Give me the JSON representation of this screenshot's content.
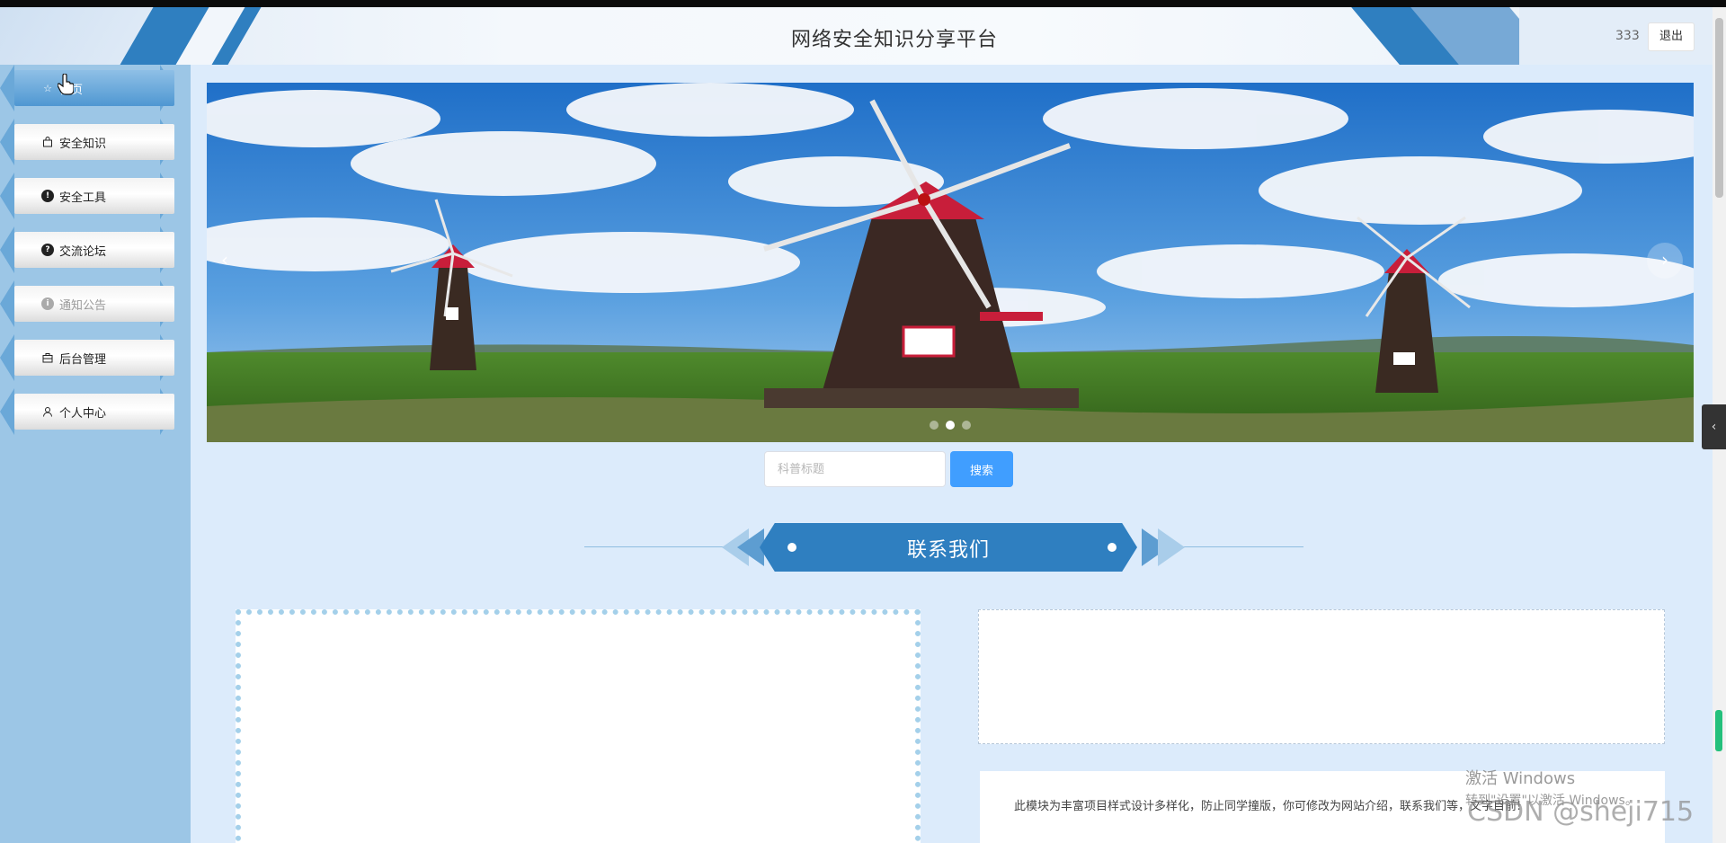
{
  "header": {
    "title": "网络安全知识分享平台",
    "username": "333",
    "logout_label": "退出"
  },
  "sidebar": {
    "items": [
      {
        "label": "首页",
        "icon": "star-icon",
        "state": "active"
      },
      {
        "label": "安全知识",
        "icon": "bag-icon",
        "state": "normal"
      },
      {
        "label": "安全工具",
        "icon": "info-circle-icon",
        "state": "normal"
      },
      {
        "label": "交流论坛",
        "icon": "question-circle-icon",
        "state": "normal"
      },
      {
        "label": "通知公告",
        "icon": "info-circle-icon",
        "state": "muted"
      },
      {
        "label": "后台管理",
        "icon": "briefcase-icon",
        "state": "normal"
      },
      {
        "label": "个人中心",
        "icon": "user-icon",
        "state": "normal"
      }
    ]
  },
  "banner": {
    "prev_icon": "‹",
    "next_icon": "›",
    "slide_count": 3,
    "active_slide": 2
  },
  "search": {
    "placeholder": "科普标题",
    "button_label": "搜索"
  },
  "section": {
    "title": "联系我们"
  },
  "intro": {
    "text": "此模块为丰富项目样式设计多样化，防止同学撞版，你可修改为网站介绍，联系我们等，文字目前!"
  },
  "overlays": {
    "windows_line1": "激活 Windows",
    "windows_line2": "转到\"设置\"以激活 Windows。",
    "csdn": "CSDN @sheji715"
  },
  "colors": {
    "accent": "#2f7fc0",
    "sidebar_bg": "#9cc6e6",
    "page_bg": "#dcebfb",
    "search_button": "#409eff"
  }
}
